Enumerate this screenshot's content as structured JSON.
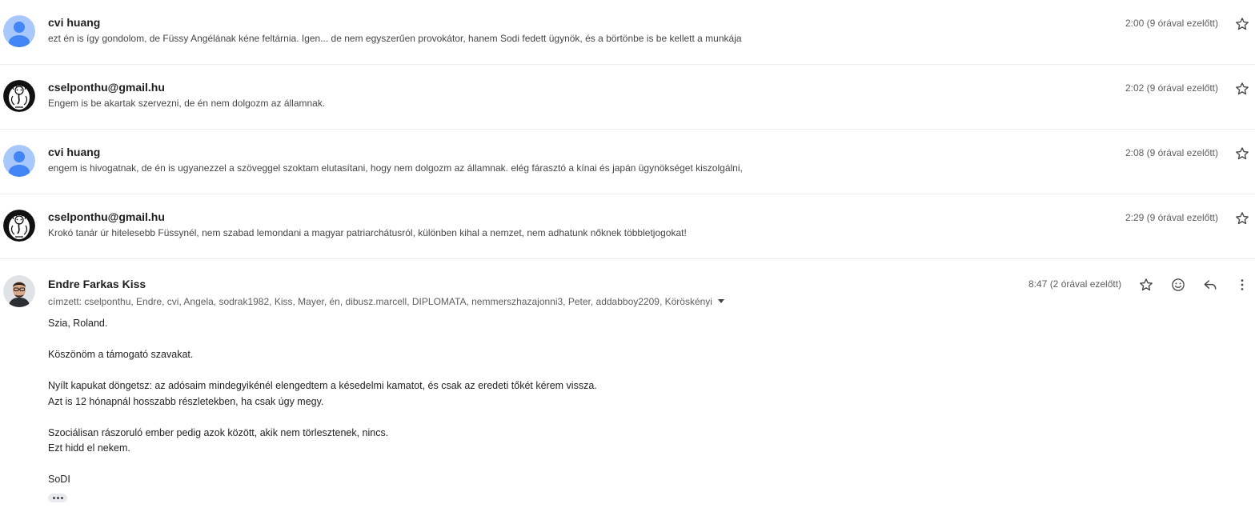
{
  "messages": [
    {
      "sender": "cvi huang",
      "snippet": "ezt én is így gondolom, de Füssy Angélának kéne feltárnia. Igen... de nem egyszerűen provokátor, hanem Sodi fedett ügynök, és a börtönbe is be kellett a munkája",
      "time": "2:00 (9 órával ezelőtt)",
      "avatar": "default-person-avatar"
    },
    {
      "sender": "cselponthu@gmail.hu",
      "snippet": "Engem is be akartak szervezni, de én nem dolgozm az államnak.",
      "time": "2:02 (9 órával ezelőtt)",
      "avatar": "ganesha-drawing-avatar"
    },
    {
      "sender": "cvi huang",
      "snippet": "engem is hivogatnak, de én is ugyanezzel a szöveggel szoktam elutasítani, hogy nem dolgozm az államnak. elég fárasztó a kínai és japán ügynökséget kiszolgálni,",
      "time": "2:08 (9 órával ezelőtt)",
      "avatar": "default-person-avatar"
    },
    {
      "sender": "cselponthu@gmail.hu",
      "snippet": "Krokó tanár úr hitelesebb Füssynél, nem szabad lemondani a magyar patriarchátusról, különben kihal a nemzet, nem adhatunk nőknek többletjogokat!",
      "time": "2:29 (9 órával ezelőtt)",
      "avatar": "ganesha-drawing-avatar"
    }
  ],
  "open_message": {
    "sender": "Endre Farkas Kiss",
    "recipients": "címzett: cselponthu, Endre, cvi, Angela, sodrak1982, Kiss, Mayer, én, dibusz.marcell, DIPLOMATA, nemmerszhazajonni3, Peter, addabboy2209, Köröskényi",
    "time": "8:47 (2 órával ezelőtt)",
    "body": {
      "line1": "Szia, Roland.",
      "line2": "Köszönöm a támogató szavakat.",
      "line3": "Nyílt kapukat döngetsz: az adósaim mindegyikénél elengedtem a késedelmi kamatot, és csak az eredeti tőkét kérem vissza.",
      "line4": "Azt is 12 hónapnál hosszabb részletekben, ha csak úgy megy.",
      "line5": "Szociálisan rászoruló ember pedig azok között, akik nem törlesztenek, nincs.",
      "line6": "Ezt hidd el nekem.",
      "line7": "SoDI"
    },
    "icons": [
      "star-icon",
      "emoji-reaction-icon",
      "reply-icon",
      "more-vert-icon",
      "show-trimmed-content-icon"
    ]
  },
  "colors": {
    "avatar_bg": "#a8c7fa",
    "avatar_fg": "#4285f4",
    "divider": "#ececec",
    "muted_text": "#5e5e5e"
  }
}
